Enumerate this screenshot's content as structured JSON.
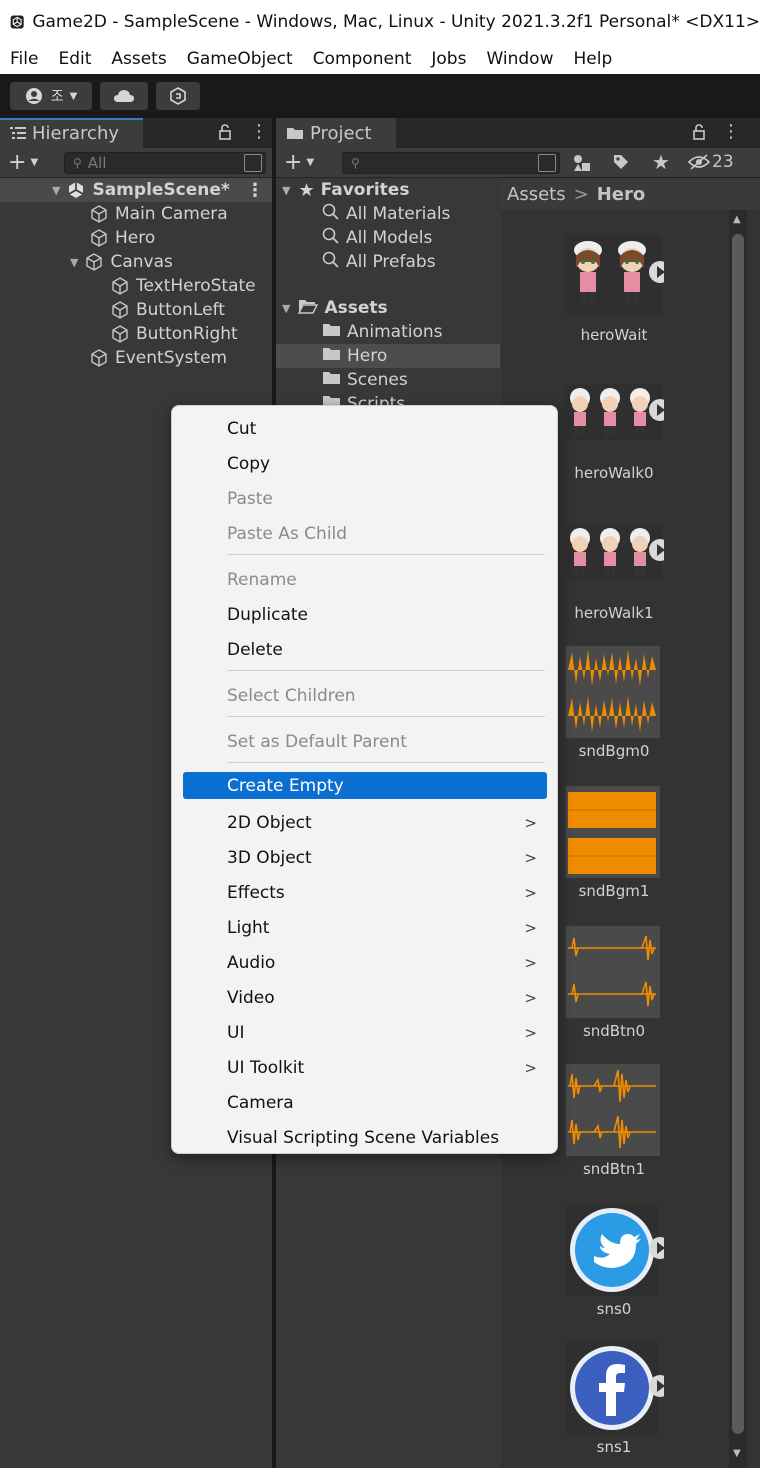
{
  "window": {
    "title": "Game2D - SampleScene - Windows, Mac, Linux - Unity 2021.3.2f1 Personal* <DX11>"
  },
  "menubar": [
    "File",
    "Edit",
    "Assets",
    "GameObject",
    "Component",
    "Jobs",
    "Window",
    "Help"
  ],
  "toolbar": {
    "account_label": "조"
  },
  "hierarchy": {
    "tab_label": "Hierarchy",
    "search_placeholder": "All",
    "scene_name": "SampleScene*",
    "items": [
      "Main Camera",
      "Hero",
      "Canvas",
      "TextHeroState",
      "ButtonLeft",
      "ButtonRight",
      "EventSystem"
    ]
  },
  "project": {
    "tab_label": "Project",
    "hidden_count": "23",
    "favorites_label": "Favorites",
    "favorites": [
      "All Materials",
      "All Models",
      "All Prefabs"
    ],
    "assets_label": "Assets",
    "folders": [
      "Animations",
      "Hero",
      "Scenes",
      "Scripts"
    ],
    "selected_folder": "Hero",
    "breadcrumb": [
      "Assets",
      "Hero"
    ],
    "breadcrumb_sep": ">",
    "assets": [
      "heroWait",
      "heroWalk0",
      "heroWalk1",
      "sndBgm0",
      "sndBgm1",
      "sndBtn0",
      "sndBtn1",
      "sns0",
      "sns1"
    ]
  },
  "context_menu": {
    "items": [
      {
        "label": "Cut",
        "enabled": true
      },
      {
        "label": "Copy",
        "enabled": true
      },
      {
        "label": "Paste",
        "enabled": false
      },
      {
        "label": "Paste As Child",
        "enabled": false
      },
      {
        "label": "Rename",
        "enabled": false
      },
      {
        "label": "Duplicate",
        "enabled": true
      },
      {
        "label": "Delete",
        "enabled": true
      },
      {
        "label": "Select Children",
        "enabled": false
      },
      {
        "label": "Set as Default Parent",
        "enabled": false
      },
      {
        "label": "Create Empty",
        "enabled": true,
        "highlighted": true
      },
      {
        "label": "2D Object",
        "enabled": true,
        "submenu": true
      },
      {
        "label": "3D Object",
        "enabled": true,
        "submenu": true
      },
      {
        "label": "Effects",
        "enabled": true,
        "submenu": true
      },
      {
        "label": "Light",
        "enabled": true,
        "submenu": true
      },
      {
        "label": "Audio",
        "enabled": true,
        "submenu": true
      },
      {
        "label": "Video",
        "enabled": true,
        "submenu": true
      },
      {
        "label": "UI",
        "enabled": true,
        "submenu": true
      },
      {
        "label": "UI Toolkit",
        "enabled": true,
        "submenu": true
      },
      {
        "label": "Camera",
        "enabled": true
      },
      {
        "label": "Visual Scripting Scene Variables",
        "enabled": true
      }
    ],
    "submenu_glyph": ">"
  },
  "colors": {
    "accent": "#0a6fd1",
    "audio_wave": "#f08c00",
    "selection": "#4d4d4d"
  }
}
